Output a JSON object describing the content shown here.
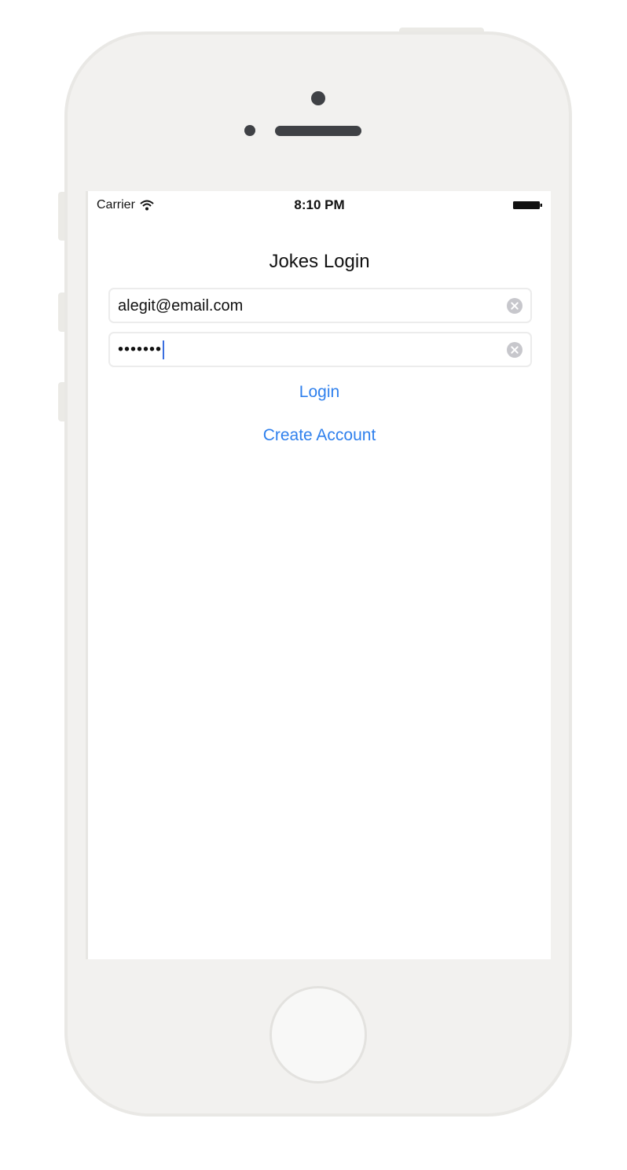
{
  "status_bar": {
    "carrier": "Carrier",
    "time": "8:10 PM",
    "icons": [
      "wifi-icon",
      "battery-icon"
    ]
  },
  "login_screen": {
    "title": "Jokes Login",
    "email_field": {
      "value": "alegit@email.com",
      "clear_icon": "clear-icon"
    },
    "password_field": {
      "value": "•••••••",
      "clear_icon": "clear-icon"
    },
    "login_label": "Login",
    "create_account_label": "Create Account"
  },
  "colors": {
    "accent": "#2f80ed",
    "caret": "#3a6ee0",
    "device_body": "#f2f1ef",
    "device_detail": "#3f4145"
  }
}
